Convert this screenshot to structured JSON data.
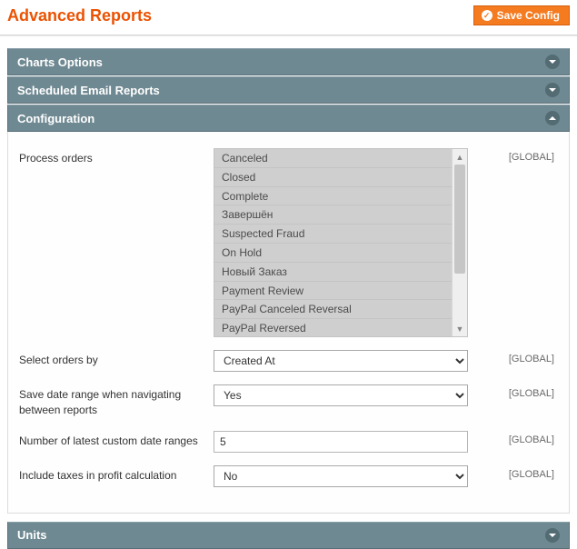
{
  "header": {
    "title": "Advanced Reports",
    "save_button": "Save Config"
  },
  "sections": {
    "charts_options": {
      "title": "Charts Options"
    },
    "scheduled_email": {
      "title": "Scheduled Email Reports"
    },
    "configuration": {
      "title": "Configuration"
    },
    "units": {
      "title": "Units"
    }
  },
  "scope": {
    "global": "[GLOBAL]"
  },
  "config": {
    "process_orders": {
      "label": "Process orders",
      "options": [
        "Canceled",
        "Closed",
        "Complete",
        "Завершён",
        "Suspected Fraud",
        "On Hold",
        "Новый Заказ",
        "Payment Review",
        "PayPal Canceled Reversal",
        "PayPal Reversed"
      ]
    },
    "select_orders_by": {
      "label": "Select orders by",
      "value": "Created At"
    },
    "save_date_range": {
      "label": "Save date range when navigating between reports",
      "value": "Yes"
    },
    "num_latest_ranges": {
      "label": "Number of latest custom date ranges",
      "value": "5"
    },
    "include_taxes": {
      "label": "Include taxes in profit calculation",
      "value": "No"
    }
  }
}
